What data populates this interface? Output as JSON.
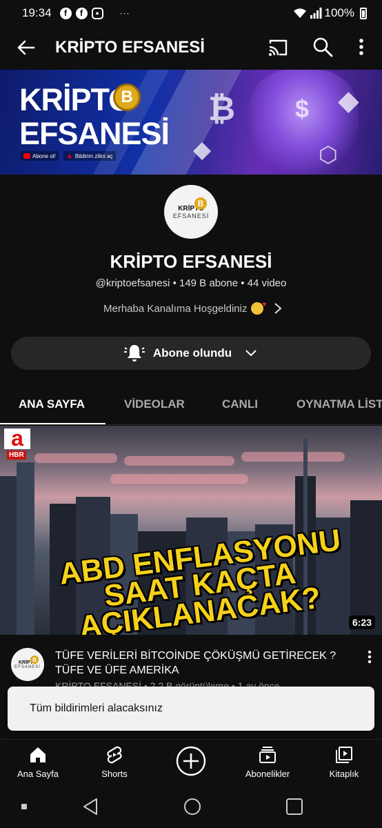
{
  "status_bar": {
    "time": "19:34",
    "more": "···",
    "battery": "100%"
  },
  "app_bar": {
    "title": "KRİPTO EFSANESİ"
  },
  "banner": {
    "line1": "KRİPTO",
    "line2": "EFSANESİ",
    "coin_symbol": "B",
    "chip_subscribe": "Abone ol!",
    "chip_bell": "Bildirim zilini aç"
  },
  "channel": {
    "avatar_line1": "KRİPTO",
    "avatar_line2": "EFSANESİ",
    "name": "KRİPTO EFSANESİ",
    "meta": "@kriptoefsanesi • 149 B abone • 44 video",
    "description": "Merhaba Kanalıma Hoşgeldiniz",
    "subscribe_label": "Abone olundu"
  },
  "tabs": [
    {
      "label": "ANA SAYFA"
    },
    {
      "label": "VİDEOLAR"
    },
    {
      "label": "CANLI"
    },
    {
      "label": "OYNATMA LİSTELERİ"
    }
  ],
  "video": {
    "thumb_logo_letter": "a",
    "thumb_logo_tag": "HBR",
    "headline_line1": "ABD ENFLASYONU",
    "headline_line2": "SAAT KAÇTA",
    "headline_line3": "AÇIKLANACAK?",
    "duration": "6:23",
    "title": "TÜFE VERİLERİ BİTCOİNDE ÇÖKÜŞMÜ GETİRECEK ? TÜFE VE ÜFE AMERİKA",
    "subtitle": "KRİPTO EFSANESİ • 2,2 B görüntüleme • 1 ay önce"
  },
  "snackbar": {
    "message": "Tüm bildirimleri alacaksınız"
  },
  "bottom_nav": {
    "home": "Ana Sayfa",
    "shorts": "Shorts",
    "subscriptions": "Abonelikler",
    "library": "Kitaplık"
  }
}
